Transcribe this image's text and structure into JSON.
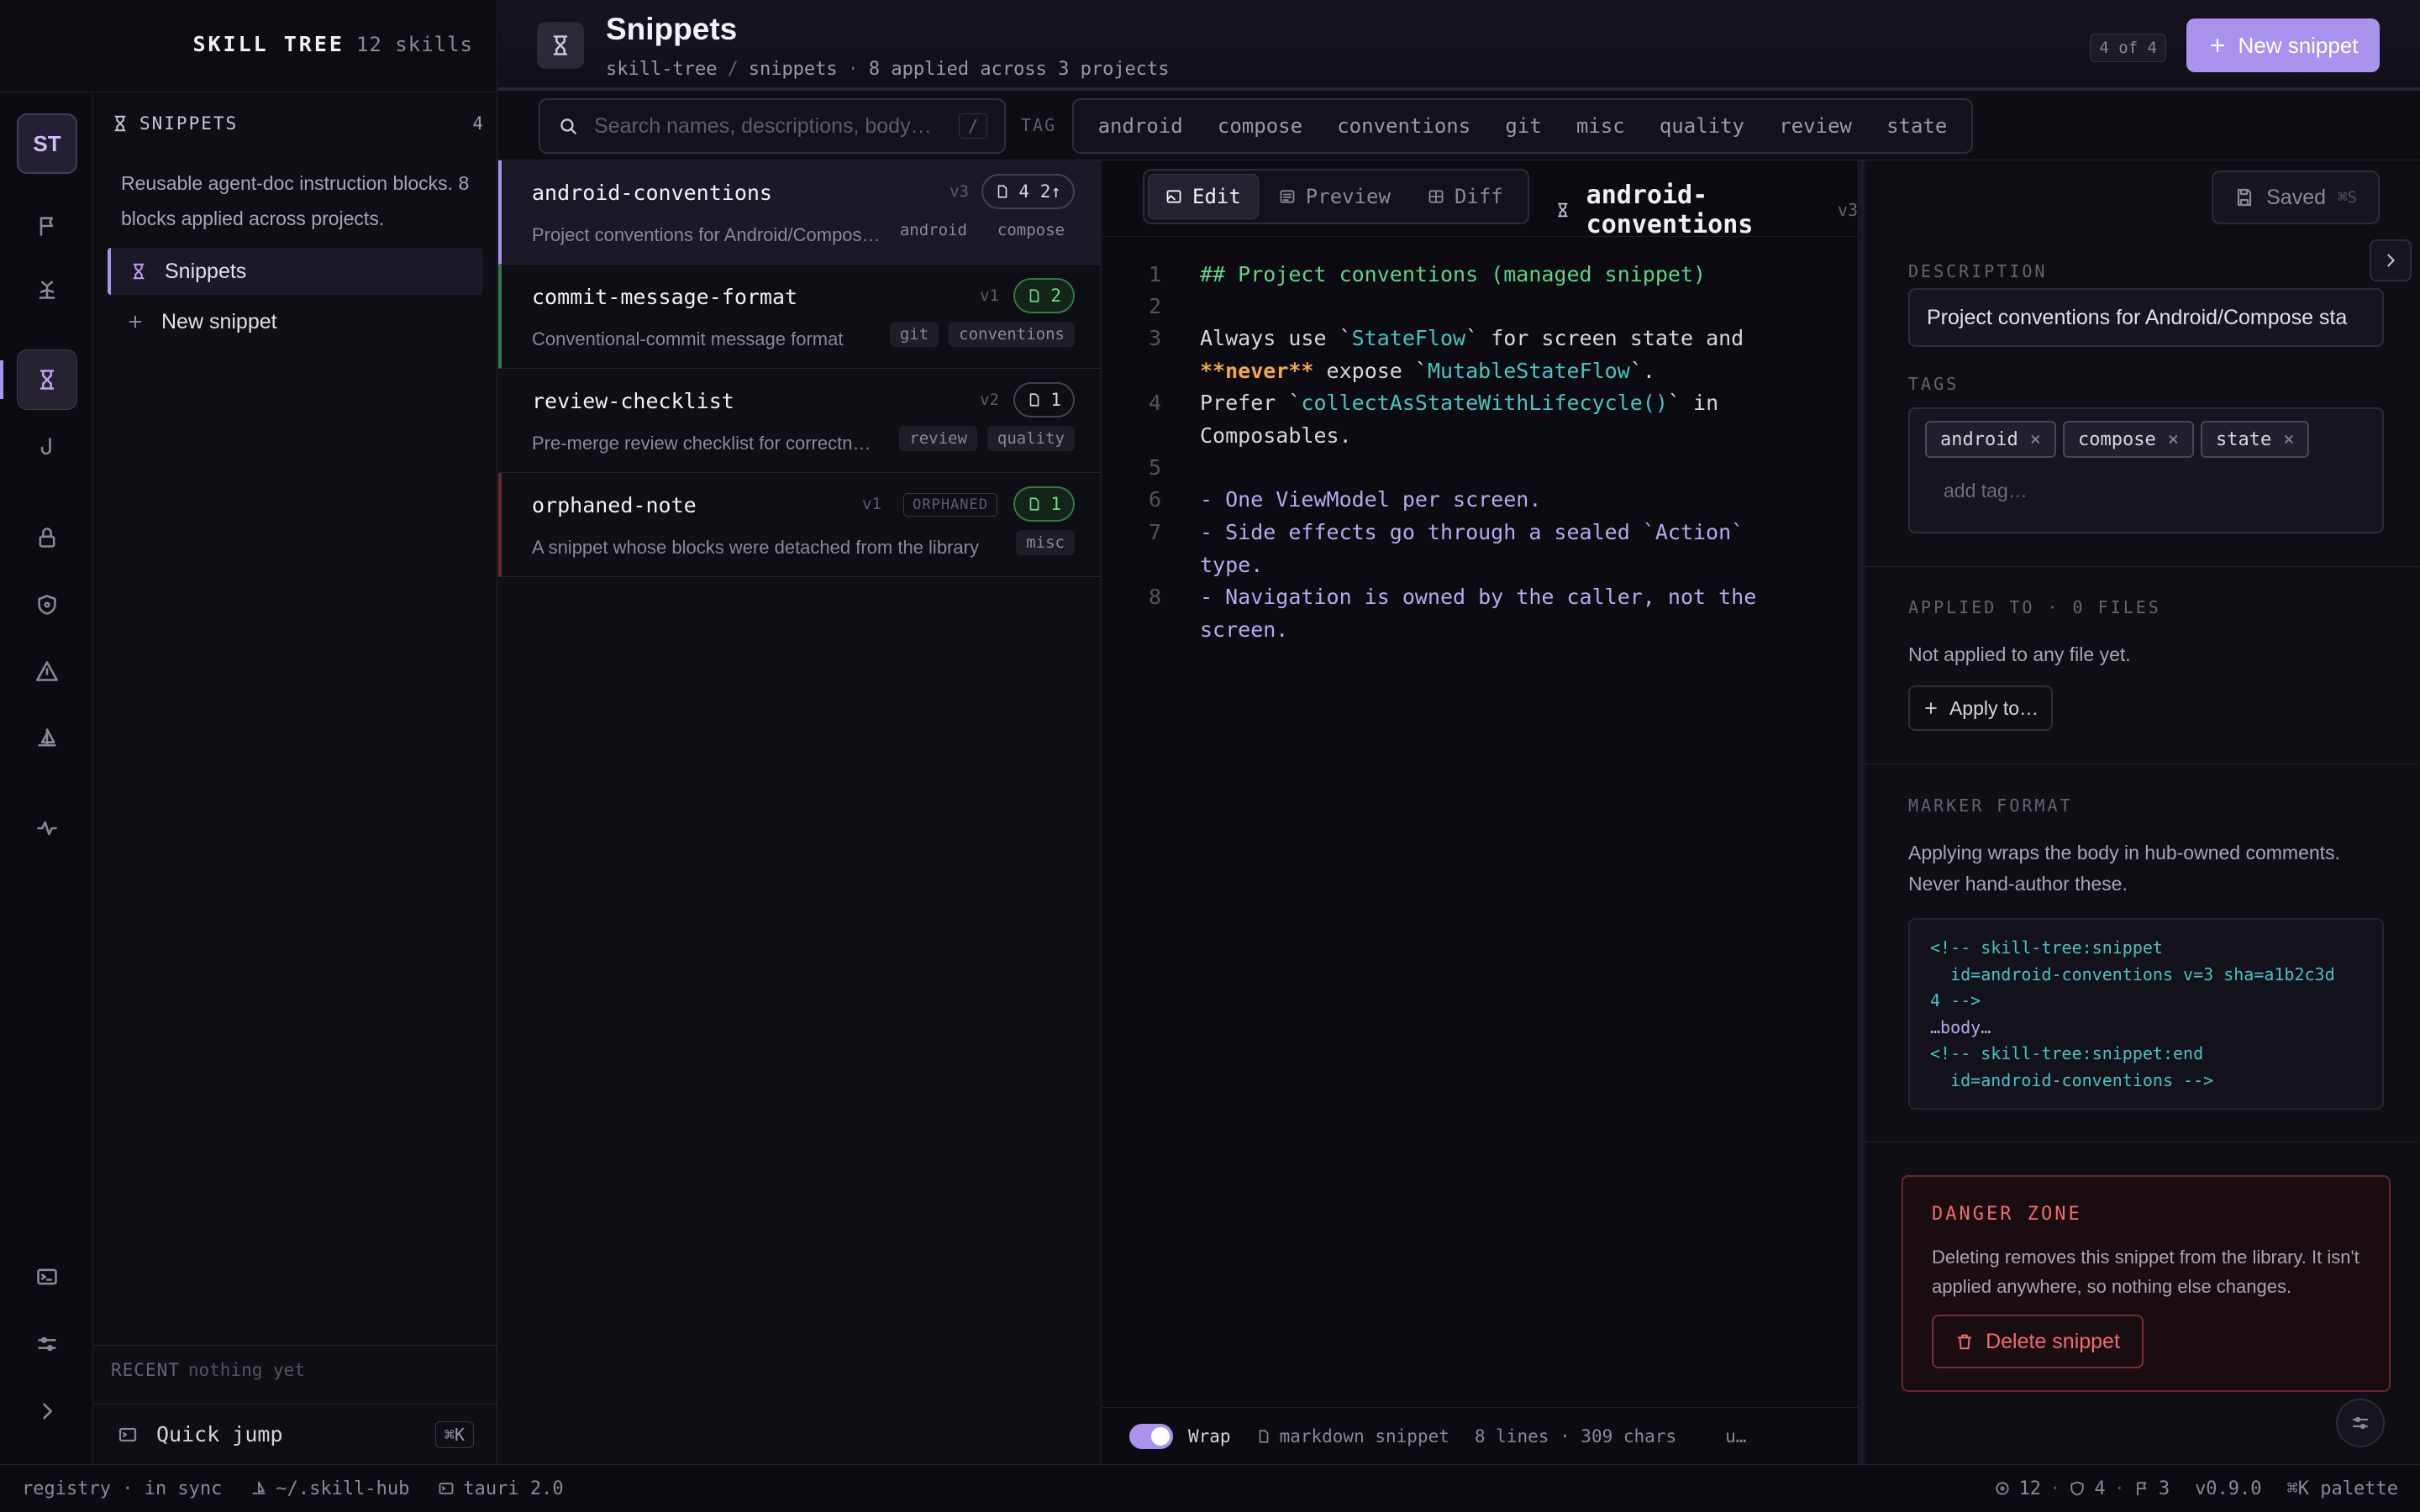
{
  "brand": {
    "name": "SKILL TREE",
    "count": "12 skills"
  },
  "header": {
    "title": "Snippets",
    "crumb1": "skill-tree",
    "crumb_sep": "/",
    "crumb2": "snippets",
    "crumb_dot": "·",
    "crumb_meta": "8 applied across 3 projects",
    "count": "4 of 4",
    "new_button": "New snippet"
  },
  "rail": {
    "avatar": "ST"
  },
  "sidebar": {
    "section": "SNIPPETS",
    "section_count": "4",
    "description": "Reusable agent-doc instruction blocks. 8 blocks applied across projects.",
    "items": [
      {
        "label": "Snippets"
      },
      {
        "label": "New snippet"
      }
    ],
    "recent_label": "RECENT",
    "recent_value": "nothing yet",
    "quick_jump": "Quick jump",
    "quick_jump_key": "⌘K"
  },
  "search": {
    "placeholder": "Search names, descriptions, body…",
    "key": "/"
  },
  "tag_filter": {
    "label": "TAG",
    "tags": [
      "android",
      "compose",
      "conventions",
      "git",
      "misc",
      "quality",
      "review",
      "state"
    ]
  },
  "snippets": [
    {
      "name": "android-conventions",
      "version": "v3",
      "desc": "Project conventions for Android/Compose state",
      "badge": "4 2↑",
      "tags": [
        "android",
        "compose"
      ]
    },
    {
      "name": "commit-message-format",
      "version": "v1",
      "desc": "Conventional-commit message format",
      "badge": "2",
      "tags": [
        "git",
        "conventions"
      ]
    },
    {
      "name": "review-checklist",
      "version": "v2",
      "desc": "Pre-merge review checklist for correctness",
      "badge": "1",
      "tags": [
        "review",
        "quality"
      ]
    },
    {
      "name": "orphaned-note",
      "version": "v1",
      "orphan_label": "ORPHANED",
      "desc": "A snippet whose blocks were detached from the library",
      "badge": "1",
      "tags": [
        "misc"
      ]
    }
  ],
  "editor": {
    "tabs": [
      "Edit",
      "Preview",
      "Diff"
    ],
    "file_name": "android-conventions",
    "file_version": "v3",
    "line_numbers": [
      "1",
      "2",
      "3",
      "4",
      "5",
      "6",
      "7",
      "8"
    ],
    "code": {
      "l1": "## Project conventions (managed snippet)",
      "l3a_1": "Always use `",
      "l3a_2": "StateFlow",
      "l3a_3": "` for screen state and",
      "l3b_1": "**",
      "l3b_2": "never",
      "l3b_3": "**",
      "l3b_4": " expose `",
      "l3b_5": "MutableStateFlow",
      "l3b_6": "`.",
      "l4a_1": "Prefer `",
      "l4a_2": "collectAsStateWithLifecycle()",
      "l4a_3": "` in",
      "l4b": "Composables.",
      "l6": "- One ViewModel per screen.",
      "l7a": "- Side effects go through a sealed `Action`",
      "l7b": "type.",
      "l8a": "- Navigation is owned by the caller, not the",
      "l8b": "screen."
    },
    "status": {
      "wrap": "Wrap",
      "kind": "markdown snippet",
      "stats": "8 lines · 309 chars",
      "extra": "u…"
    }
  },
  "inspector": {
    "saved": "Saved",
    "saved_key": "⌘S",
    "description_label": "DESCRIPTION",
    "description_value": "Project conventions for Android/Compose sta",
    "tags_label": "TAGS",
    "tags": [
      "android",
      "compose",
      "state"
    ],
    "tag_remove": "×",
    "add_tag_placeholder": "add tag…",
    "applied_label": "APPLIED TO · 0 FILES",
    "applied_text": "Not applied to any file yet.",
    "apply_button": "Apply to…",
    "marker_label": "MARKER FORMAT",
    "marker_text": "Applying wraps the body in hub-owned comments. Never hand-author these.",
    "marker_code": [
      "<!-- skill-tree:snippet",
      "  id=android-conventions v=3 sha=a1b2c3d",
      "4 -->",
      "…body…",
      "<!-- skill-tree:snippet:end",
      "  id=android-conventions -->"
    ],
    "danger_title": "DANGER ZONE",
    "danger_text": "Deleting removes this snippet from the library. It isn't applied anywhere, so nothing else changes.",
    "delete_button": "Delete snippet"
  },
  "footer": {
    "registry": "registry · in sync",
    "path": "~/.skill-hub",
    "runtime": "tauri 2.0",
    "skills": "12",
    "dot": "·",
    "snippets": "4",
    "flags": "3",
    "version": "v0.9.0",
    "palette": "⌘K palette"
  },
  "colors": {
    "accent": "#a993ef",
    "danger": "#ef6a6f",
    "success": "#6fdc8f"
  }
}
